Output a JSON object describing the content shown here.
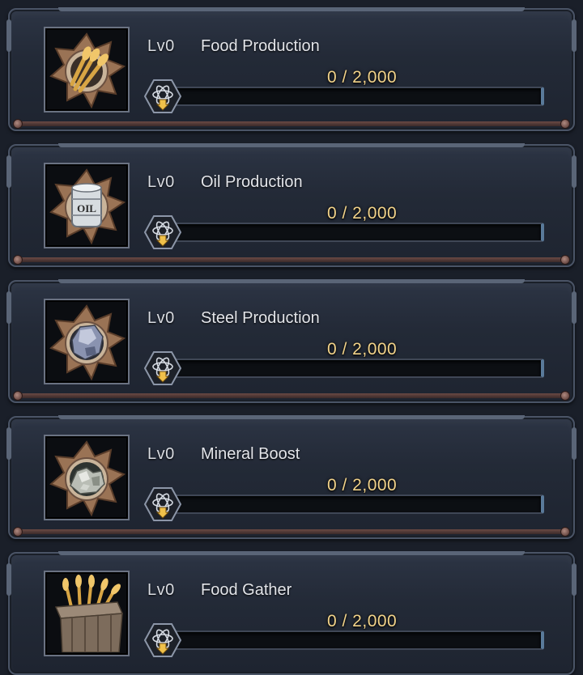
{
  "items": [
    {
      "level": "Lv0",
      "name": "Food Production",
      "progress_text": "0 / 2,000",
      "progress": 0,
      "icon": "wheat-medal-icon"
    },
    {
      "level": "Lv0",
      "name": "Oil Production",
      "progress_text": "0 / 2,000",
      "progress": 0,
      "icon": "oil-barrel-medal-icon"
    },
    {
      "level": "Lv0",
      "name": "Steel Production",
      "progress_text": "0 / 2,000",
      "progress": 0,
      "icon": "steel-ore-medal-icon"
    },
    {
      "level": "Lv0",
      "name": "Mineral Boost",
      "progress_text": "0 / 2,000",
      "progress": 0,
      "icon": "mineral-medal-icon"
    },
    {
      "level": "Lv0",
      "name": "Food Gather",
      "progress_text": "0 / 2,000",
      "progress": 0,
      "icon": "wheat-crate-icon"
    }
  ],
  "colors": {
    "panel": "#232a37",
    "panel_border": "#4a5466",
    "progress_text": "#f2d38a",
    "bar_bg": "#0c0f13",
    "accent_rail": "#6b4a44"
  }
}
